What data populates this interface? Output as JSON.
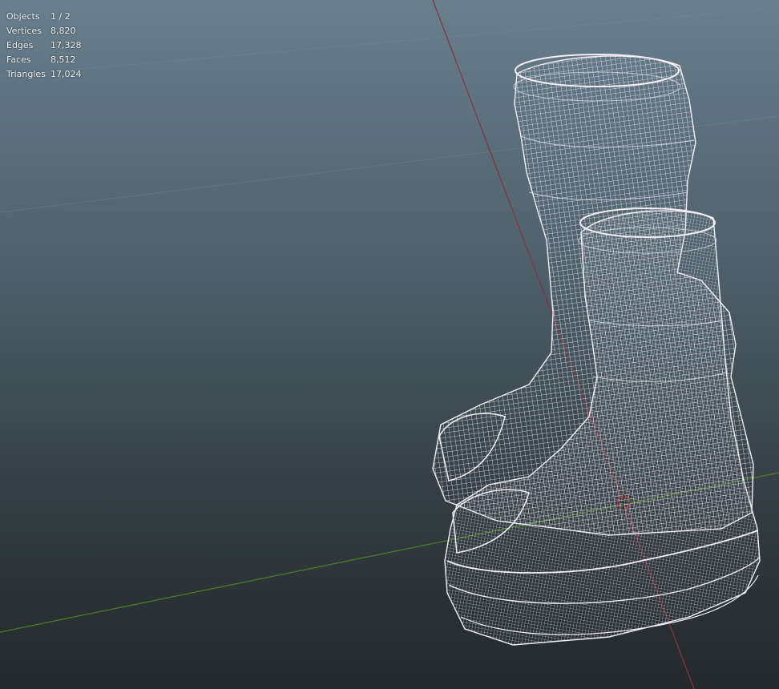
{
  "stats": {
    "objects": {
      "label": "Objects",
      "value": "1 / 2"
    },
    "vertices": {
      "label": "Vertices",
      "value": "8,820"
    },
    "edges": {
      "label": "Edges",
      "value": "17,328"
    },
    "faces": {
      "label": "Faces",
      "value": "8,512"
    },
    "triangles": {
      "label": "Triangles",
      "value": "17,024"
    }
  },
  "colors": {
    "wireframe": "#f1eef8",
    "x_axis": "#86333a",
    "y_axis": "#4b7f28",
    "grid_line": "#7a8c96",
    "origin_marker": "#d23a3a"
  }
}
